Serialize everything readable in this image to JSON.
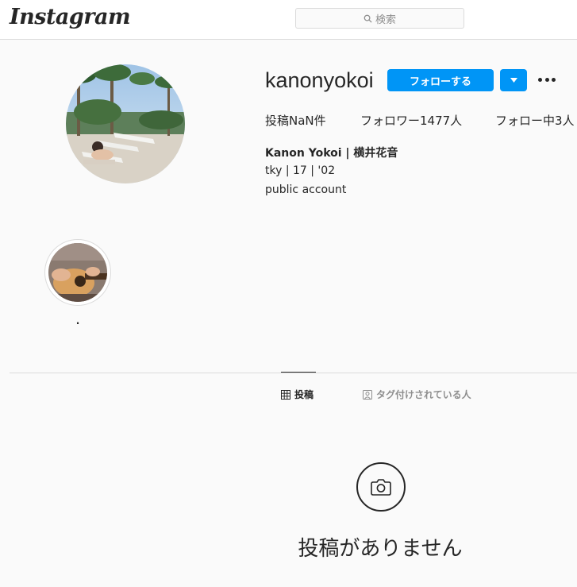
{
  "header": {
    "logo": "Instagram",
    "search_placeholder": "検索"
  },
  "profile": {
    "username": "kanonyokoi",
    "follow_label": "フォローする",
    "stats": {
      "posts": "投稿NaN件",
      "followers": "フォロワー1477人",
      "following": "フォロー中3人"
    },
    "full_name": "Kanon Yokoi | 横井花音",
    "bio_lines": [
      "tky | 17 | '02",
      "public account"
    ]
  },
  "highlights": [
    {
      "label": "."
    }
  ],
  "tabs": [
    {
      "label": "投稿",
      "active": true,
      "icon": "grid-icon"
    },
    {
      "label": "タグ付けされている人",
      "active": false,
      "icon": "tagged-person-icon"
    }
  ],
  "empty_state": {
    "icon": "camera-icon",
    "title": "投稿がありません"
  },
  "colors": {
    "accent": "#0095f6",
    "background": "#fafafa",
    "text": "#262626",
    "border": "#dbdbdb"
  }
}
